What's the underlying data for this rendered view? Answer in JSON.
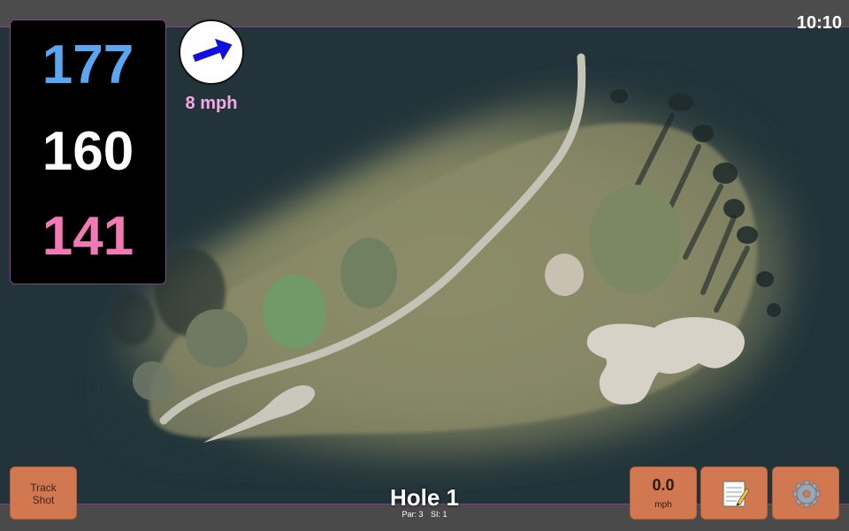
{
  "status_bar": {
    "time": "10:10"
  },
  "distances": {
    "back": "177",
    "middle": "160",
    "front": "141"
  },
  "wind": {
    "speed": "8 mph",
    "direction_icon": "wind-arrow-icon",
    "arrow_color": "#1010e0"
  },
  "hole": {
    "title": "Hole 1",
    "par_label": "Par: 3",
    "si_label": "SI: 1"
  },
  "buttons": {
    "track_shot": "Track\nShot",
    "speed_value": "0.0",
    "speed_unit": "mph",
    "notes_icon": "notepad-icon",
    "settings_icon": "gear-icon"
  },
  "colors": {
    "back_distance": "#5aa6f0",
    "middle_distance": "#ffffff",
    "front_distance": "#f17ab5",
    "button": "#d27850",
    "accent_border": "#8a3f8a"
  }
}
